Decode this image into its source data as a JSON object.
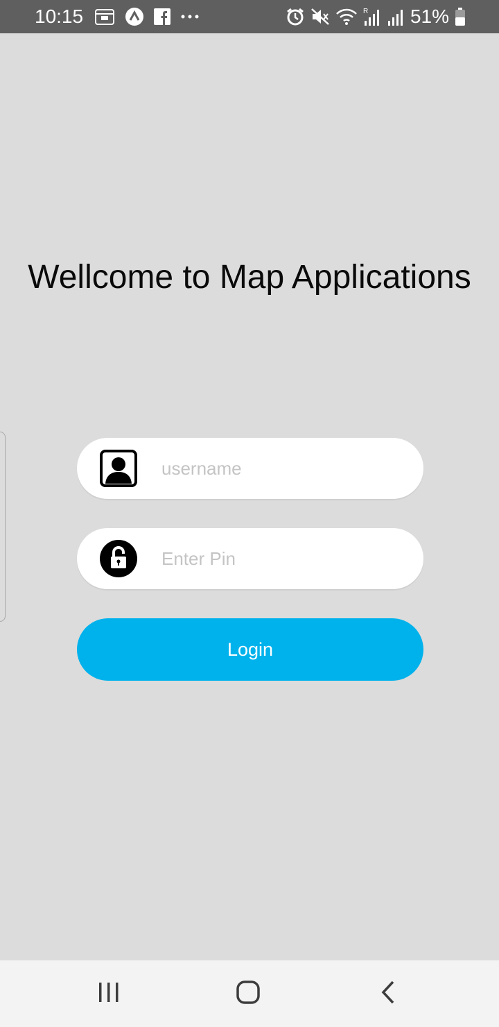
{
  "status_bar": {
    "time": "10:15",
    "battery_percent": "51%",
    "left_icons": [
      "calendar-notification-icon",
      "app-notification-icon",
      "facebook-icon",
      "more-notifications-icon"
    ],
    "right_icons": [
      "alarm-icon",
      "mute-icon",
      "wifi-icon",
      "signal-roaming-icon",
      "signal-icon",
      "battery-icon"
    ]
  },
  "main": {
    "title": "Wellcome to Map Applications",
    "username_field": {
      "value": "",
      "placeholder": "username",
      "icon": "user-avatar-icon"
    },
    "pin_field": {
      "value": "",
      "placeholder": "Enter Pin",
      "icon": "padlock-icon"
    },
    "login_button": {
      "label": "Login"
    }
  },
  "nav_bar": {
    "buttons": [
      "recents",
      "home",
      "back"
    ]
  },
  "colors": {
    "background": "#dcdcdc",
    "status_bar": "#5f5f5f",
    "login_button": "#00b2ec",
    "field_background": "#ffffff",
    "nav_bar": "#f3f3f3"
  }
}
